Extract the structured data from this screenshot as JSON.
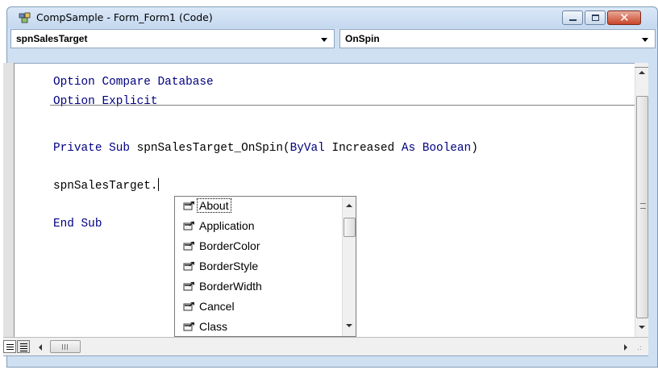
{
  "window": {
    "title": "CompSample - Form_Form1 (Code)",
    "close_glyph": "✕"
  },
  "object_combo": {
    "value": "spnSalesTarget"
  },
  "procedure_combo": {
    "value": "OnSpin"
  },
  "code": {
    "line1_kw1": "Option",
    "line1_rest": " Compare Database",
    "line2_kw1": "Option",
    "line2_rest": " Explicit",
    "line3_kw": "Private Sub",
    "line3_mid": " spnSalesTarget_OnSpin(",
    "line3_byval": "ByVal",
    "line3_mid2": " Increased ",
    "line3_as": "As",
    "line3_boolean": " Boolean",
    "line3_end": ")",
    "line4": "spnSalesTarget.",
    "line5": "End Sub"
  },
  "intellisense": {
    "items": [
      {
        "label": "About",
        "icon": "property-icon"
      },
      {
        "label": "Application",
        "icon": "property-icon"
      },
      {
        "label": "BorderColor",
        "icon": "property-icon"
      },
      {
        "label": "BorderStyle",
        "icon": "property-icon"
      },
      {
        "label": "BorderWidth",
        "icon": "property-icon"
      },
      {
        "label": "Cancel",
        "icon": "property-icon"
      },
      {
        "label": "Class",
        "icon": "property-icon"
      }
    ],
    "selected": "About"
  },
  "colors": {
    "keyword": "#00007f",
    "window_frame": "#cfe0f2",
    "close_button": "#c94528"
  }
}
